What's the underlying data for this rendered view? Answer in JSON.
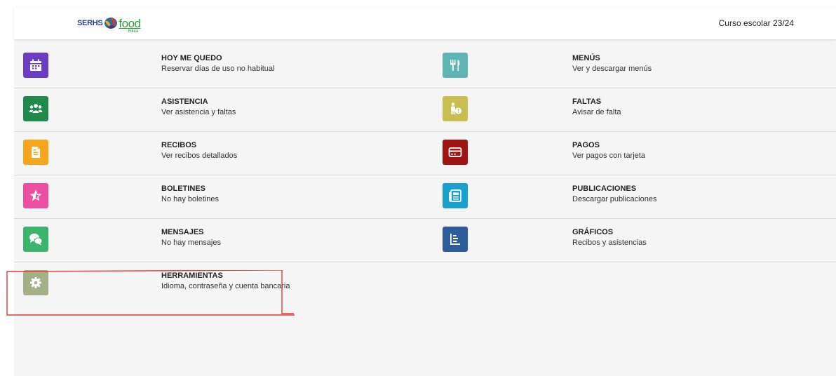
{
  "header": {
    "logo_serhs": "SERHS",
    "logo_food": "food",
    "logo_sub": "Educa",
    "course": "Curso escolar 23/24"
  },
  "menu": [
    {
      "title": "HOY ME QUEDO",
      "subtitle": "Reservar días de uso no habitual",
      "icon": "calendar-icon",
      "color": "#6a3dc4"
    },
    {
      "title": "MENÚS",
      "subtitle": "Ver y descargar menús",
      "icon": "cutlery-icon",
      "color": "#5fb4b4"
    },
    {
      "title": "ASISTENCIA",
      "subtitle": "Ver asistencia y faltas",
      "icon": "users-icon",
      "color": "#1f8a4c"
    },
    {
      "title": "FALTAS",
      "subtitle": "Avisar de falta",
      "icon": "absence-icon",
      "color": "#c9be52"
    },
    {
      "title": "RECIBOS",
      "subtitle": "Ver recibos detallados",
      "icon": "receipt-icon",
      "color": "#f7a51c"
    },
    {
      "title": "PAGOS",
      "subtitle": "Ver pagos con tarjeta",
      "icon": "credit-card-icon",
      "color": "#a01414"
    },
    {
      "title": "BOLETINES",
      "subtitle": "No hay boletines",
      "icon": "star-bulletin-icon",
      "color": "#ee4ea0"
    },
    {
      "title": "PUBLICACIONES",
      "subtitle": "Descargar publicaciones",
      "icon": "newspaper-icon",
      "color": "#1aa0cc"
    },
    {
      "title": "MENSAJES",
      "subtitle": "No hay mensajes",
      "icon": "chat-bubbles-icon",
      "color": "#3bb46e"
    },
    {
      "title": "GRÁFICOS",
      "subtitle": "Recibos y asistencias",
      "icon": "chart-icon",
      "color": "#2c5d9a"
    },
    {
      "title": "HERRAMIENTAS",
      "subtitle": "Idioma, contraseña y cuenta bancaria",
      "icon": "gear-icon",
      "color": "#a4b186"
    }
  ],
  "annotation_color": "#e53935"
}
